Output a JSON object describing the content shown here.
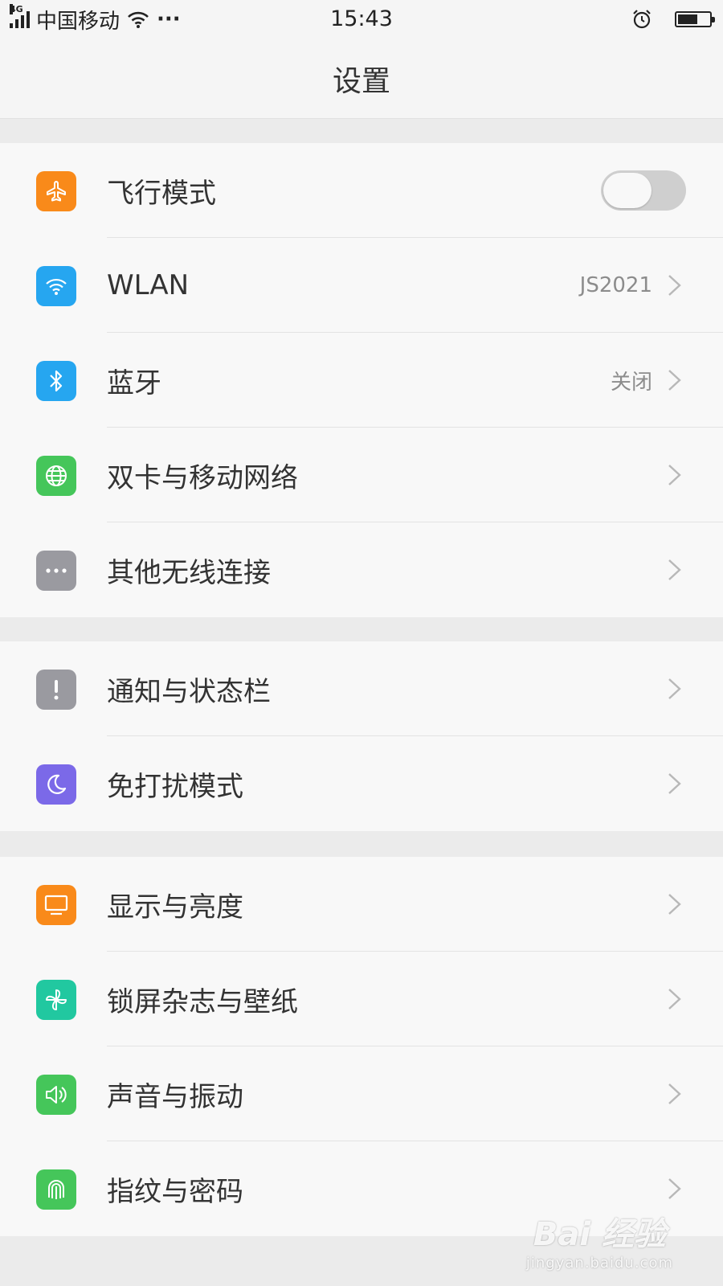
{
  "status_bar": {
    "network": "4G",
    "carrier": "中国移动",
    "more": "···",
    "time": "15:43",
    "battery_level": 0.62
  },
  "header": {
    "title": "设置"
  },
  "groups": [
    {
      "items": [
        {
          "label": "飞行模式",
          "icon": "airplane-icon",
          "icon_color": "#f98a1a",
          "control": "toggle",
          "toggle_on": false
        },
        {
          "label": "WLAN",
          "icon": "wifi-icon",
          "icon_color": "#26a6f0",
          "value": "JS2021",
          "control": "chevron"
        },
        {
          "label": "蓝牙",
          "icon": "bluetooth-icon",
          "icon_color": "#26a6f0",
          "value": "关闭",
          "control": "chevron"
        },
        {
          "label": "双卡与移动网络",
          "icon": "globe-icon",
          "icon_color": "#45c65a",
          "control": "chevron"
        },
        {
          "label": "其他无线连接",
          "icon": "more-icon",
          "icon_color": "#9a9aa0",
          "control": "chevron"
        }
      ]
    },
    {
      "items": [
        {
          "label": "通知与状态栏",
          "icon": "exclamation-icon",
          "icon_color": "#9a9aa0",
          "control": "chevron"
        },
        {
          "label": "免打扰模式",
          "icon": "moon-icon",
          "icon_color": "#7b69e8",
          "control": "chevron"
        }
      ]
    },
    {
      "items": [
        {
          "label": "显示与亮度",
          "icon": "monitor-icon",
          "icon_color": "#f98a1a",
          "control": "chevron"
        },
        {
          "label": "锁屏杂志与壁纸",
          "icon": "pinwheel-icon",
          "icon_color": "#21c8a0",
          "control": "chevron"
        },
        {
          "label": "声音与振动",
          "icon": "speaker-icon",
          "icon_color": "#45c65a",
          "control": "chevron"
        },
        {
          "label": "指纹与密码",
          "icon": "fingerprint-icon",
          "icon_color": "#45c65a",
          "control": "chevron"
        }
      ]
    }
  ],
  "watermark": {
    "line1": "Bai 经验",
    "line2": "jingyan.baidu.com"
  }
}
